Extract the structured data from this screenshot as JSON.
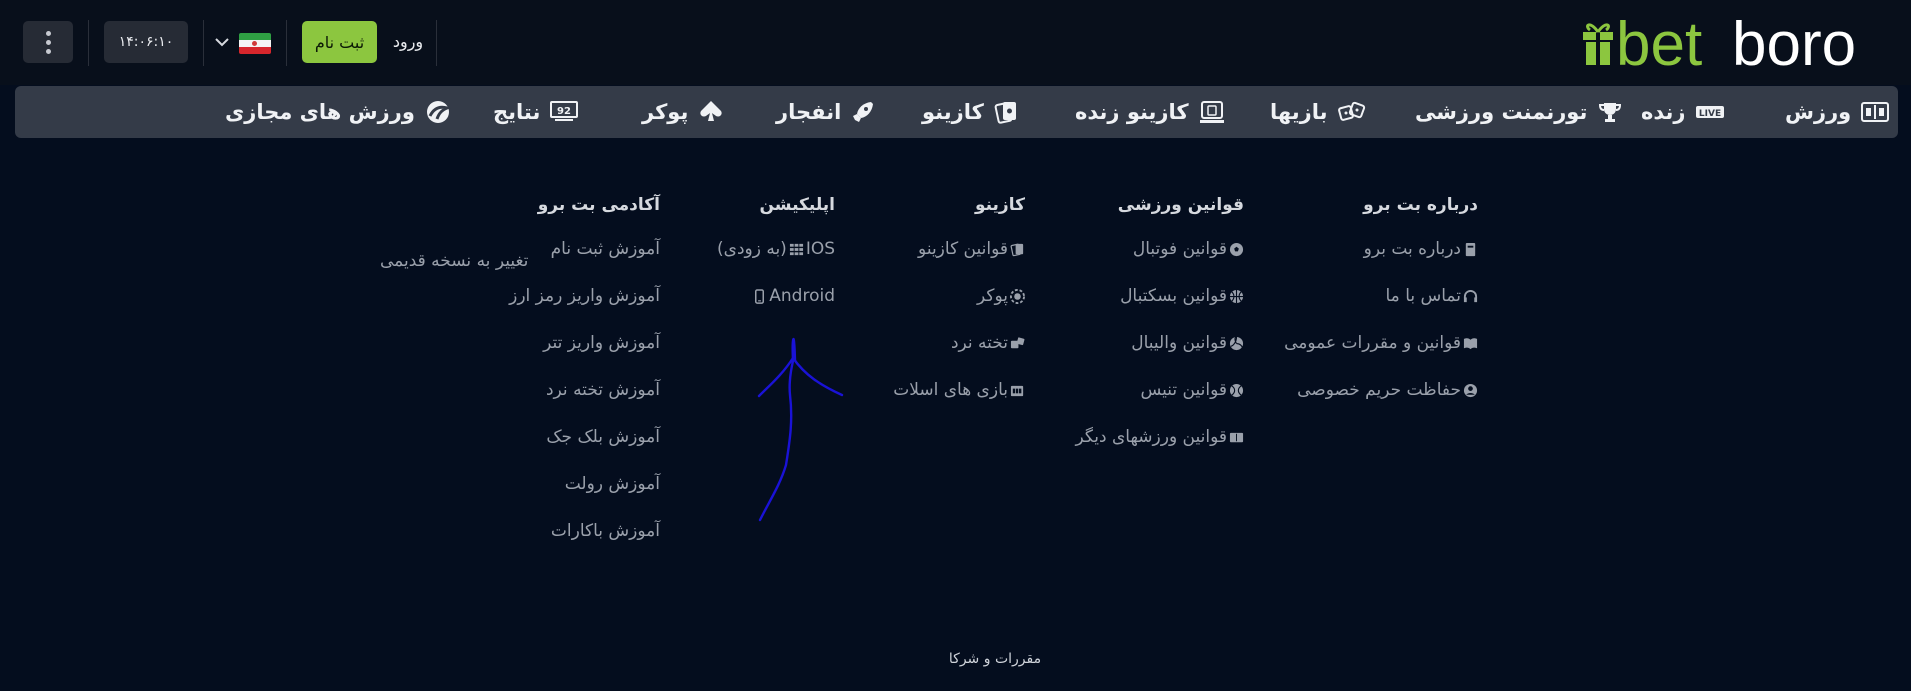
{
  "header": {
    "clock": "۱۴:۰۶:۱۰",
    "register_label": "ثبت نام",
    "login_label": "ورود",
    "language_flag": "iran-flag",
    "brand": {
      "part1": "bet",
      "part2": "boro",
      "accent": "#8cc63f"
    }
  },
  "nav": {
    "items": [
      {
        "label": "ورزش",
        "icon": "scoreboard-icon"
      },
      {
        "label": "زنده",
        "icon": "live-icon",
        "badge": "LIVE"
      },
      {
        "label": "تورنمنت ورزشی",
        "icon": "trophy-icon"
      },
      {
        "label": "بازیها",
        "icon": "dice-icon"
      },
      {
        "label": "کازینو زنده",
        "icon": "live-casino-icon"
      },
      {
        "label": "کازینو",
        "icon": "cards-icon"
      },
      {
        "label": "انفجار",
        "icon": "rocket-icon"
      },
      {
        "label": "پوکر",
        "icon": "spade-icon"
      },
      {
        "label": "نتایج",
        "icon": "results-icon",
        "badge": "92"
      },
      {
        "label": "ورزش های مجازی",
        "icon": "virtual-sports-icon"
      }
    ]
  },
  "footer": {
    "columns": [
      {
        "title": "درباره بت برو",
        "links": [
          {
            "label": "درباره بت برو",
            "icon": "book-icon"
          },
          {
            "label": "تماس با ما",
            "icon": "headset-icon"
          },
          {
            "label": "قوانین و مقررات عمومی",
            "icon": "open-book-icon"
          },
          {
            "label": "حفاظت حریم خصوصی",
            "icon": "user-circle-icon"
          }
        ]
      },
      {
        "title": "قوانین ورزشی",
        "links": [
          {
            "label": "قوانین فوتبال",
            "icon": "football-icon"
          },
          {
            "label": "قوانین بسکتبال",
            "icon": "basketball-icon"
          },
          {
            "label": "قوانین والیبال",
            "icon": "volleyball-icon"
          },
          {
            "label": "قوانین تنیس",
            "icon": "tennis-icon"
          },
          {
            "label": "قوانین ورزشهای دیگر",
            "icon": "scoreboard-icon"
          }
        ]
      },
      {
        "title": "کازینو",
        "links": [
          {
            "label": "قوانین کازینو",
            "icon": "cards-icon"
          },
          {
            "label": "پوکر",
            "icon": "chip-icon"
          },
          {
            "label": "تخته نرد",
            "icon": "dice-icon"
          },
          {
            "label": "بازی های اسلات",
            "icon": "slot-icon"
          }
        ]
      },
      {
        "title": "اپلیکیشن",
        "links": [
          {
            "label": "IOS",
            "icon": "grid-icon",
            "suffix": "(به زودی)"
          },
          {
            "label": "Android",
            "icon": "phone-icon"
          }
        ]
      },
      {
        "title": "آکادمی بت برو",
        "links": [
          {
            "label": "آموزش ثبت نام"
          },
          {
            "label": "آموزش واریز رمز ارز"
          },
          {
            "label": "آموزش واریز تتر"
          },
          {
            "label": "آموزش تخته نرد"
          },
          {
            "label": "آموزش بلک جک"
          },
          {
            "label": "آموزش رولت"
          },
          {
            "label": "آموزش باکارات"
          }
        ]
      }
    ],
    "switch_version": "تغییر به نسخه قدیمی",
    "legal": "مقررات و شرکا"
  },
  "annotation": {
    "color": "#1a12d6"
  }
}
